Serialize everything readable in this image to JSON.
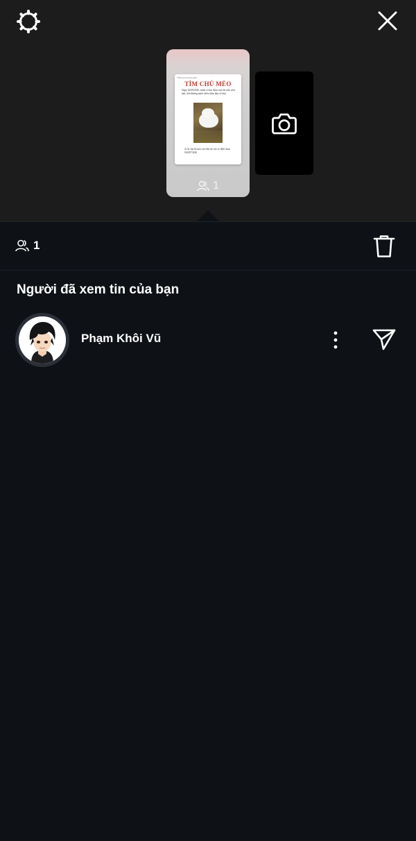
{
  "colors": {
    "background": "#0e1116",
    "top_background": "#1c1c1c",
    "text": "#ffffff",
    "poster_title": "#c0392b"
  },
  "icons": {
    "settings": "gear-icon",
    "close": "close-icon",
    "camera": "camera-icon",
    "viewers": "viewers-icon",
    "delete": "trash-icon",
    "more": "more-vertical-icon",
    "send": "send-icon"
  },
  "story": {
    "poster_header": "Thông tin trường sinh",
    "poster_title": "TÌM CHỦ MÈO",
    "poster_text": "Ngày 20/08/2026, mình có tìm được một bé mèo như ảnh, trên đường mình chiều hôm đưa về nhà.",
    "poster_footer": "Ai là chủ bé mèo xin liên hệ vào số điện thoại 0363973458",
    "view_count": "1"
  },
  "views_bar": {
    "count": "1"
  },
  "section": {
    "title": "Người đã xem tin của bạn"
  },
  "viewers": [
    {
      "name": "Phạm Khôi Vũ"
    }
  ]
}
